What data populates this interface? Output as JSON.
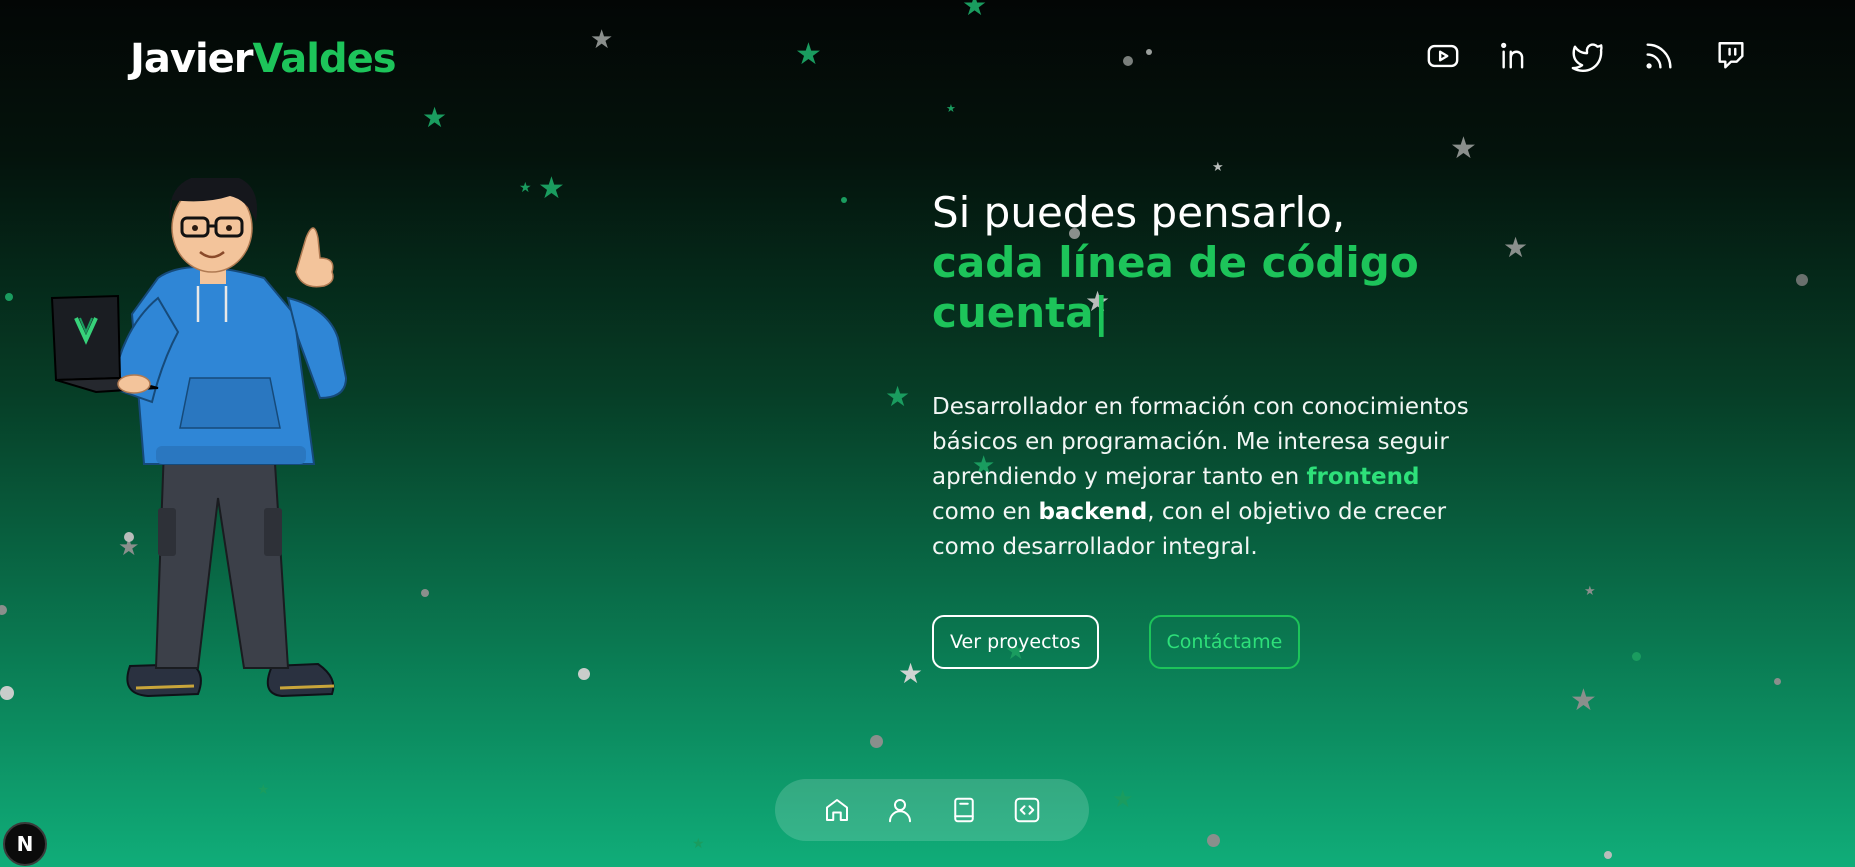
{
  "header": {
    "logo_first": "Javier",
    "logo_second": "Valdes",
    "socials": [
      {
        "name": "youtube-icon"
      },
      {
        "name": "linkedin-icon"
      },
      {
        "name": "twitter-icon"
      },
      {
        "name": "rss-icon"
      },
      {
        "name": "twitch-icon"
      }
    ]
  },
  "hero": {
    "headline_line1": "Si puedes pensarlo,",
    "headline_line2": "cada línea de código",
    "headline_line3": "cuenta",
    "cursor": "|",
    "desc_part1": "Desarrollador en formación con conocimientos básicos en programación. Me interesa seguir aprendiendo y mejorar tanto en ",
    "desc_highlight": "frontend",
    "desc_part2": " como en ",
    "desc_bold": "backend",
    "desc_part3": ", con el objetivo de crecer como desarrollador integral.",
    "btn_projects": "Ver proyectos",
    "btn_contact": "Contáctame"
  },
  "dock": {
    "items": [
      "home-icon",
      "user-icon",
      "book-icon",
      "code-icon"
    ]
  },
  "badge": {
    "letter": "N"
  },
  "colors": {
    "accent": "#1dc45a",
    "accent_light": "#2ee07a",
    "bg_top": "#030605",
    "bg_bottom": "#10ad79"
  }
}
